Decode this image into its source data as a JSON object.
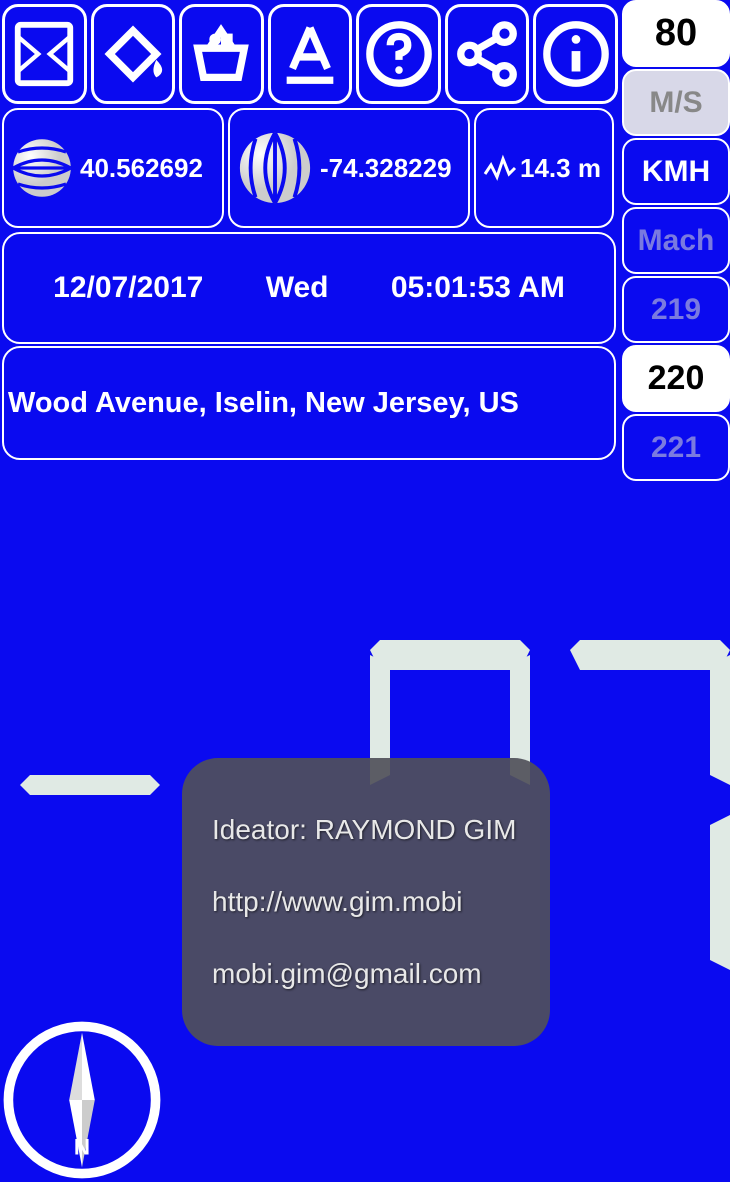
{
  "toolbar": {
    "icons": [
      "map-icon",
      "paint-bucket-icon",
      "basket-icon",
      "text-style-icon",
      "help-icon",
      "share-icon",
      "info-icon"
    ]
  },
  "right": {
    "speed_limit": "80",
    "units": [
      "M/S",
      "KMH",
      "Mach"
    ],
    "selected_unit": "KMH",
    "wheel": [
      "219",
      "220",
      "221"
    ],
    "wheel_selected": "220"
  },
  "coords": {
    "latitude": "40.562692",
    "longitude": "-74.328229",
    "altitude": "14.3 m"
  },
  "datetime": {
    "date": "12/07/2017",
    "day": "Wed",
    "time": "05:01:53 AM"
  },
  "address": "Wood Avenue, Iselin, New Jersey, US",
  "toast": {
    "ideator": "Ideator: RAYMOND GIM",
    "url": "http://www.gim.mobi",
    "email": "mobi.gim@gmail.com"
  },
  "compass": {
    "label": "N"
  }
}
